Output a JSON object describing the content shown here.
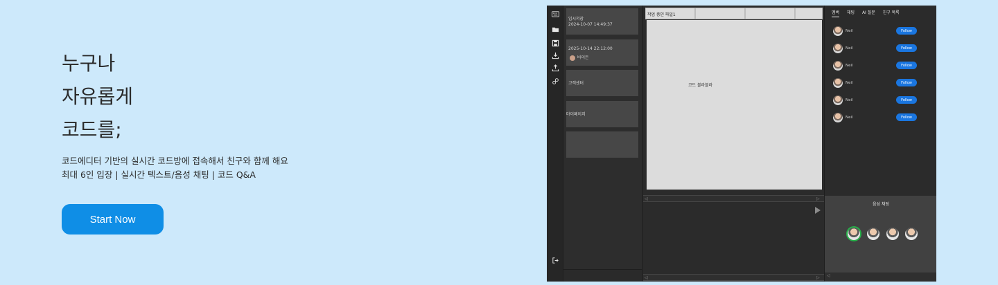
{
  "hero": {
    "lines": [
      "누구나",
      "자유롭게",
      "코드를;"
    ],
    "desc1": "코드에디터 기반의 실시간 코드방에 접속해서 친구와 함께 해요",
    "desc2": "최대 6인 입장 | 실시간 텍스트/음성 채팅 | 코드 Q&A",
    "cta": "Start Now"
  },
  "app": {
    "rail_icons": [
      "keyboard-icon",
      "folder-icon",
      "save-icon",
      "download-icon",
      "upload-icon",
      "link-icon",
      "logout-icon"
    ],
    "rooms": [
      {
        "line1": "임시저장",
        "line2": "2024-10-07 14:49:37"
      },
      {
        "line1": "2025-10-14 22:12:00",
        "user": "바이든"
      },
      {
        "line1": "고객센터"
      },
      {
        "line1": "마이페이지"
      },
      {
        "line1": ""
      }
    ],
    "tabs": [
      "작업 중인 파일1",
      "",
      "",
      ""
    ],
    "code_text": "코드 블라블라",
    "side_tabs": [
      "멤버",
      "채팅",
      "AI 질문",
      "친구 목록"
    ],
    "members": [
      {
        "name": "Neil",
        "action": "Follow"
      },
      {
        "name": "Neil",
        "action": "Follow"
      },
      {
        "name": "Neil",
        "action": "Follow"
      },
      {
        "name": "Neil",
        "action": "Follow"
      },
      {
        "name": "Neil",
        "action": "Follow"
      },
      {
        "name": "Neil",
        "action": "Follow"
      }
    ],
    "voice_title": "음성 채팅",
    "colors": {
      "accent": "#0f8ee6",
      "follow": "#1a76e0",
      "speaking": "#27b24a",
      "bg": "#cde9fb"
    }
  }
}
